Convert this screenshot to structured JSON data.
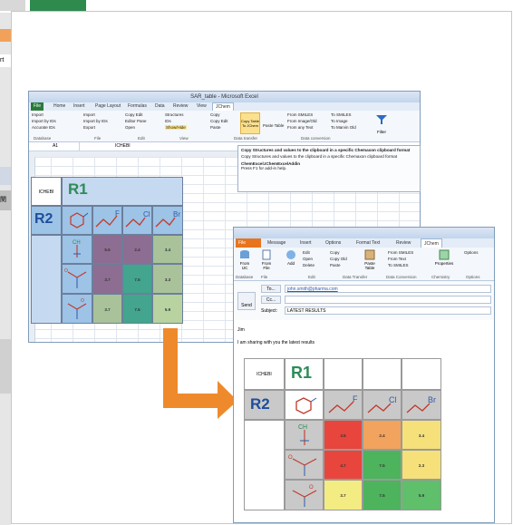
{
  "background": {
    "left_strip_bands": [
      {
        "label": "rt"
      },
      {
        "label": "関"
      }
    ]
  },
  "excel": {
    "window_title": "SAR_table - Microsoft Excel",
    "tabs": [
      "File",
      "Home",
      "Insert",
      "Page Layout",
      "Formulas",
      "Data",
      "Review",
      "View",
      "JChem"
    ],
    "active_tab": "JChem",
    "ribbon": {
      "database": [
        "Import",
        "Import by IDs",
        "Accurate IDs"
      ],
      "file": [
        "Import",
        "Import by IDs",
        "Export"
      ],
      "edit": [
        "Copy Edit",
        "Editor Pane",
        "Open"
      ],
      "view": [
        "Structures",
        "IDs",
        "Show/Hide"
      ],
      "copy": [
        "Copy",
        "Copy Edit",
        "Paste"
      ],
      "copy_table": "Copy Table To JChem",
      "paste_table": "Paste Table",
      "smiles": [
        "From SMILES",
        "From Image/Old",
        "From any Text"
      ],
      "to": [
        "To SMILES",
        "To Image",
        "To Marvin Old"
      ],
      "filter": "Filter",
      "groups": [
        "Database",
        "File",
        "Edit",
        "View",
        "Data transfer",
        "Data conversion"
      ]
    },
    "name_box": "A1",
    "formula": "ICHEBI",
    "tooltip": {
      "title": "Copy Structures and values to the clipboard in a specific Chemaxon clipboard format",
      "body": "Copy Structures and values to the clipboard in a specific Chemaxon clipboard format",
      "addin": "ChemExcel.IChemExcelAddin",
      "help": "Press F1 for add-in help."
    },
    "grid": {
      "corner_label": "ICHEBI",
      "r1_label": "R1",
      "r2_label": "R2",
      "values": [
        [
          "5.5",
          "2.4",
          "3.4"
        ],
        [
          "3.7",
          "7.5",
          "3.3"
        ],
        [
          "3.7",
          "7.5",
          "5.9"
        ]
      ]
    },
    "colors": {
      "header_blue": "#9dc3e6",
      "light_blue": "#c5d9f0",
      "purple": "#8e6d92",
      "teal": "#43a58d",
      "green_gray": "#a9c29a",
      "light_green": "#b8d3a0"
    }
  },
  "outlook": {
    "tabs": [
      "File",
      "Message",
      "Insert",
      "Options",
      "Format Text",
      "Review",
      "JChem"
    ],
    "ribbon": {
      "from_ic": "From IJC",
      "from_file": "From File",
      "add": "Add",
      "edit": [
        "Edit",
        "Open",
        "Delete"
      ],
      "copy": [
        "Copy",
        "Copy Old",
        "Paste"
      ],
      "paste_table": "Paste Table",
      "from": [
        "From SMILES",
        "From Text",
        "To SMILES"
      ],
      "properties": "Properties",
      "options": "Options",
      "groups": [
        "Database",
        "File",
        "Edit",
        "Data Transfer",
        "Data Conversion",
        "Chemistry",
        "Options"
      ]
    },
    "send_label": "Send",
    "to_label": "To...",
    "cc_label": "Cc...",
    "subject_label": "Subject:",
    "to_value": "john.smith@pharma.com",
    "subject_value": "LATEST RESULTS",
    "greeting": "Jim",
    "body_line": "I am sharing with you the latest results",
    "grid": {
      "corner_label": "ICHEBI",
      "r1_label": "R1",
      "r2_label": "R2",
      "values": [
        [
          "3.5",
          "2.4",
          "3.4"
        ],
        [
          "4.7",
          "7.5",
          "2.3"
        ],
        [
          "3.7",
          "7.5",
          "5.9"
        ]
      ],
      "value_colors": [
        [
          "#e8453c",
          "#f2a35e",
          "#f6e07a"
        ],
        [
          "#e8453c",
          "#4db35d",
          "#f6e07a"
        ],
        [
          "#f3ec82",
          "#4db35d",
          "#5fbf6a"
        ]
      ]
    }
  },
  "arrow_color": "#ef8a2c"
}
